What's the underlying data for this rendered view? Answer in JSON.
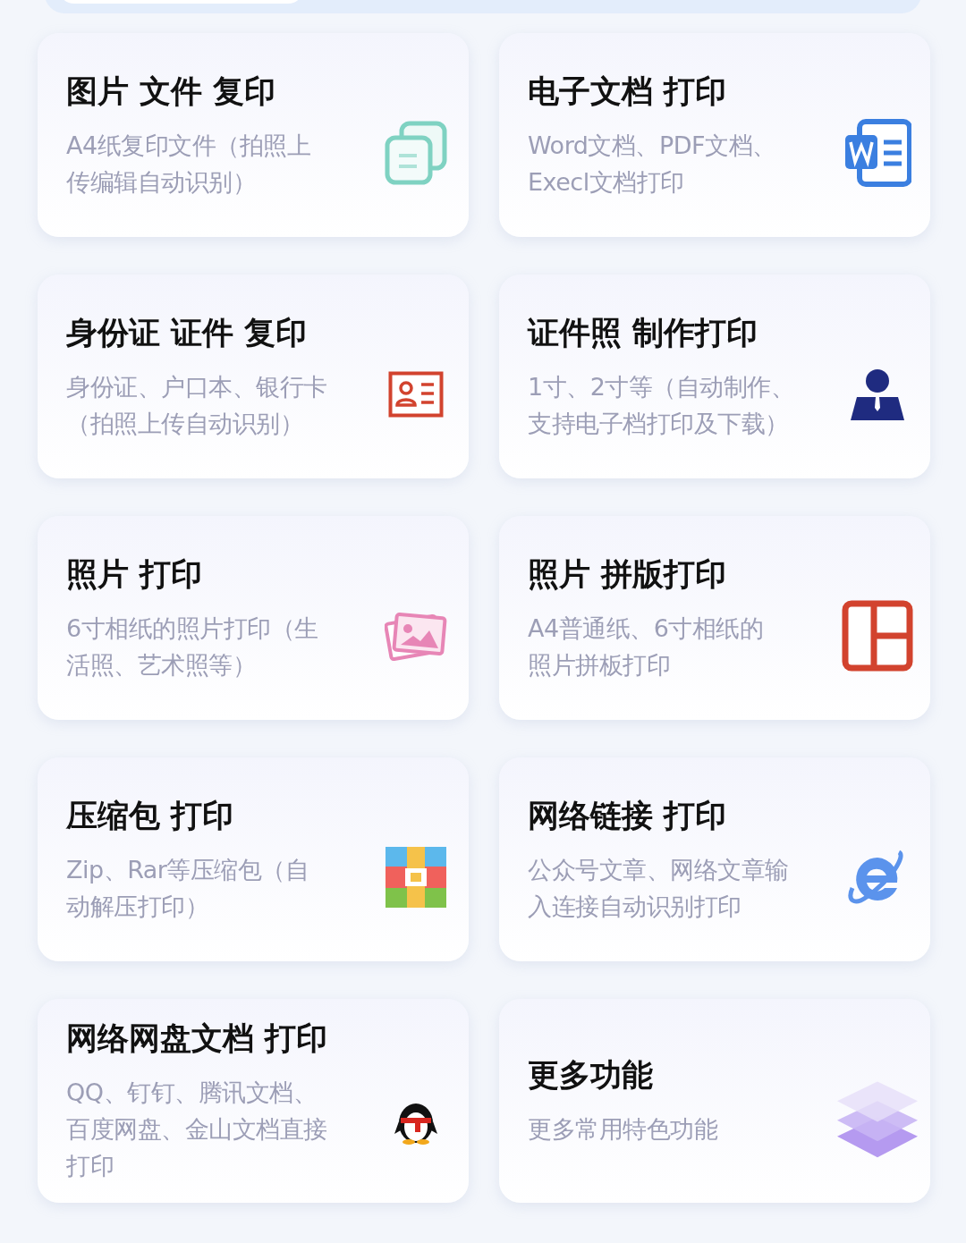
{
  "cards": [
    {
      "title": "图片 文件 复印",
      "description": [
        "A4纸复印文件（拍照上",
        "传编辑自动识别）"
      ]
    },
    {
      "title": "电子文档 打印",
      "description": [
        "Word文档、PDF文档、",
        "Execl文档打印"
      ]
    },
    {
      "title": "身份证 证件 复印",
      "description": [
        "身份证、户口本、银行卡",
        "（拍照上传自动识别）"
      ]
    },
    {
      "title": "证件照 制作打印",
      "description": [
        "1寸、2寸等（自动制作、",
        "支持电子档打印及下载）"
      ]
    },
    {
      "title": "照片 打印",
      "description": [
        "6寸相纸的照片打印（生",
        "活照、艺术照等）"
      ]
    },
    {
      "title": "照片 拼版打印",
      "description": [
        "A4普通纸、6寸相纸的",
        "照片拼板打印"
      ]
    },
    {
      "title": "压缩包 打印",
      "description": [
        "Zip、Rar等压缩包（自",
        "动解压打印）"
      ]
    },
    {
      "title": "网络链接 打印",
      "description": [
        "公众号文章、网络文章输",
        "入连接自动识别打印"
      ]
    },
    {
      "title": "网络网盘文档 打印",
      "description": [
        "QQ、钉钉、腾讯文档、",
        "百度网盘、金山文档直接",
        "打印"
      ]
    },
    {
      "title": "更多功能",
      "description": [
        "更多常用特色功能"
      ]
    }
  ]
}
